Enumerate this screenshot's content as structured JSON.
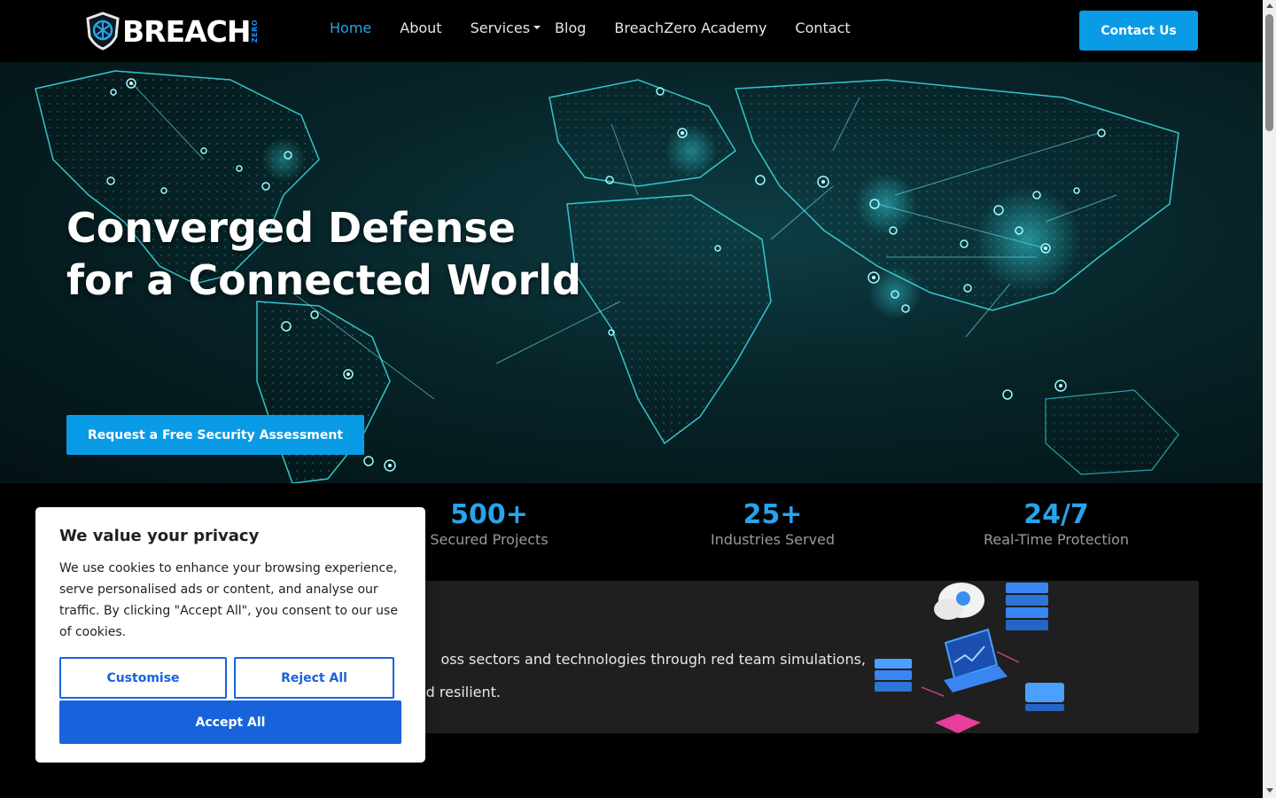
{
  "nav": {
    "logo_text": "BREACH",
    "logo_subtext": "ZERO",
    "links": [
      "Home",
      "About",
      "Services",
      "Blog",
      "BreachZero Academy",
      "Contact"
    ],
    "cta": "Contact Us"
  },
  "hero": {
    "title_line1": "Converged Defense",
    "title_line2": "for a Connected World",
    "cta": "Request a Free Security Assessment"
  },
  "stats": [
    {
      "value": "500+",
      "label": "Secured Projects"
    },
    {
      "value": "25+",
      "label": "Industries Served"
    },
    {
      "value": "24/7",
      "label": "Real-Time Protection"
    }
  ],
  "about": {
    "text_line1": "oss sectors and technologies through red team simulations,",
    "text_line2": "d resilient."
  },
  "cookie": {
    "title": "We value your privacy",
    "body": "We use cookies to enhance your browsing experience, serve personalised ads or content, and analyse our traffic. By clicking \"Accept All\", you consent to our use of cookies.",
    "customise": "Customise",
    "reject": "Reject All",
    "accept": "Accept All"
  },
  "colors": {
    "accent": "#0a9be6",
    "cookie_blue": "#1863dc"
  }
}
